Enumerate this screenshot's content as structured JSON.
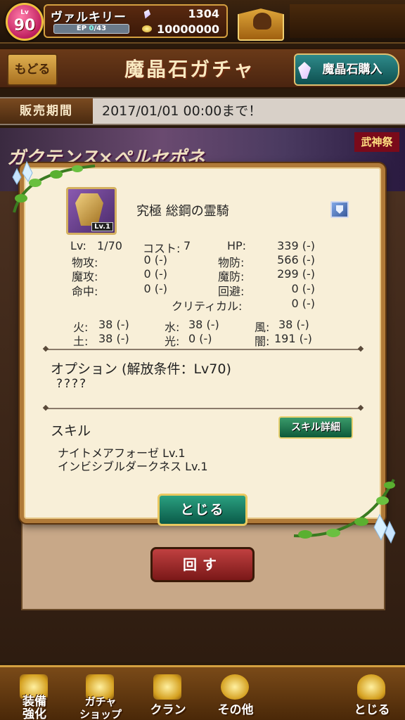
{
  "player": {
    "level_tag": "Lv",
    "level": "90",
    "name": "ヴァルキリー",
    "ep_label": "EP",
    "ep_value": "0",
    "ep_max": "/43",
    "gems": "1304",
    "coins": "10000000"
  },
  "header": {
    "back_label": "もどる",
    "title": "魔晶石ガチャ",
    "buy_label": "魔晶石購入"
  },
  "period": {
    "label": "販売期間",
    "value": "2017/01/01 00:00まで！"
  },
  "banner": {
    "title": "ガクテンス×ペルセポネ",
    "tag": "武神祭"
  },
  "item": {
    "thumb_level": "Lv.1",
    "name": "究極 総鋼の霊騎",
    "stats": {
      "lv_label": "Lv:",
      "lv_value": "1/70",
      "cost_label": "コスト:",
      "cost_value": "7",
      "hp_label": "HP:",
      "hp_value": "339 (-)",
      "patk_label": "物攻:",
      "patk_value": "0 (-)",
      "pdef_label": "物防:",
      "pdef_value": "566 (-)",
      "matk_label": "魔攻:",
      "matk_value": "0 (-)",
      "mdef_label": "魔防:",
      "mdef_value": "299 (-)",
      "hit_label": "命中:",
      "hit_value": "0 (-)",
      "eva_label": "回避:",
      "eva_value": "0 (-)",
      "crit_label": "クリティカル:",
      "crit_value": "0 (-)"
    },
    "elements": {
      "fire_label": "火:",
      "fire_value": "38 (-)",
      "water_label": "水:",
      "water_value": "38 (-)",
      "wind_label": "風:",
      "wind_value": "38 (-)",
      "earth_label": "土:",
      "earth_value": "38 (-)",
      "light_label": "光:",
      "light_value": "0 (-)",
      "dark_label": "闇:",
      "dark_value": "191 (-)"
    },
    "option_title": "オプション (解放条件：Lv70)",
    "option_value": "????",
    "skill_title": "スキル",
    "skill_detail_label": "スキル詳細",
    "skills": [
      "ナイトメアフォーゼ  Lv.1",
      "インビシブルダークネス  Lv.1"
    ]
  },
  "modal": {
    "close_label": "とじる"
  },
  "spin_label": "回す",
  "nav": [
    {
      "label": "装備\n強化",
      "icon": "equip-icon"
    },
    {
      "label": "ガチャ\nショップ",
      "icon": "gacha-icon"
    },
    {
      "label": "クラン",
      "icon": "clan-icon"
    },
    {
      "label": "その他",
      "icon": "gear-icon"
    },
    {
      "label": "とじる",
      "icon": "close-bag-icon"
    }
  ]
}
